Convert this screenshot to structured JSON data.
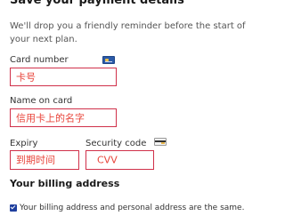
{
  "header": {
    "title": "Save your payment details",
    "subtitle": "We'll drop you a friendly reminder before the start of your next plan."
  },
  "fields": {
    "card_number": {
      "label": "Card number",
      "value": "卡号",
      "icon": "credit-card-icon"
    },
    "name_on_card": {
      "label": "Name on card",
      "value": "信用卡上的名字"
    },
    "expiry": {
      "label": "Expiry",
      "value": "到期时间"
    },
    "security_code": {
      "label": "Security code",
      "value": "CVV",
      "icon": "security-code-card-icon"
    }
  },
  "billing": {
    "heading": "Your billing address",
    "checkbox_label": "Your billing address and personal address are the same.",
    "checkbox_checked": true
  },
  "colors": {
    "field_border": "#d0304a",
    "field_text": "#e8443a",
    "checkbox": "#1f3f9e"
  }
}
